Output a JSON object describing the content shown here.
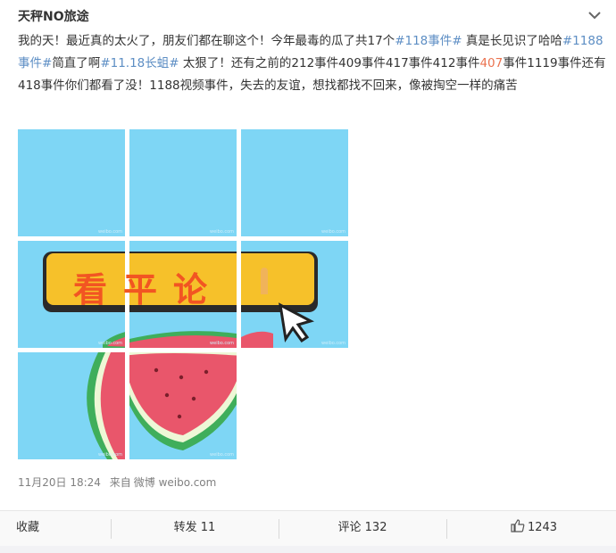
{
  "post": {
    "author": "天秤NO旅途",
    "text": [
      {
        "t": "我的天！最近真的太火了，朋友们都在聊这个！今年最毒的瓜了共17个",
        "type": "plain"
      },
      {
        "t": "#118事件#",
        "type": "tag"
      },
      {
        "t": " 真是长见识了哈哈",
        "type": "plain"
      },
      {
        "t": "#1188事件#",
        "type": "tag"
      },
      {
        "t": "简直了啊",
        "type": "plain"
      },
      {
        "t": "#11.18长蛆#",
        "type": "tag"
      },
      {
        "t": " 太狠了！还有之前的212事件409事件417事件412事件",
        "type": "plain"
      },
      {
        "t": "407",
        "type": "red"
      },
      {
        "t": "事件1119事件还有418事件你们都看了没！1188视频事件，失去的友谊，想找都找不回来，像被掏空一样的痛苦",
        "type": "plain"
      }
    ],
    "image_text": "看平论",
    "watermark": "weibo.com",
    "timestamp": "11月20日 18:24",
    "source_prefix": "来自",
    "source": "微博 weibo.com"
  },
  "actions": {
    "favorite": "收藏",
    "repost": "转发 11",
    "comment": "评论 132",
    "like": "1243"
  },
  "colors": {
    "tag": "#5d8ec4",
    "highlight": "#eb7350",
    "image_bg": "#7ed6f5",
    "banner": "#f6c12a",
    "banner_text": "#f25522"
  }
}
